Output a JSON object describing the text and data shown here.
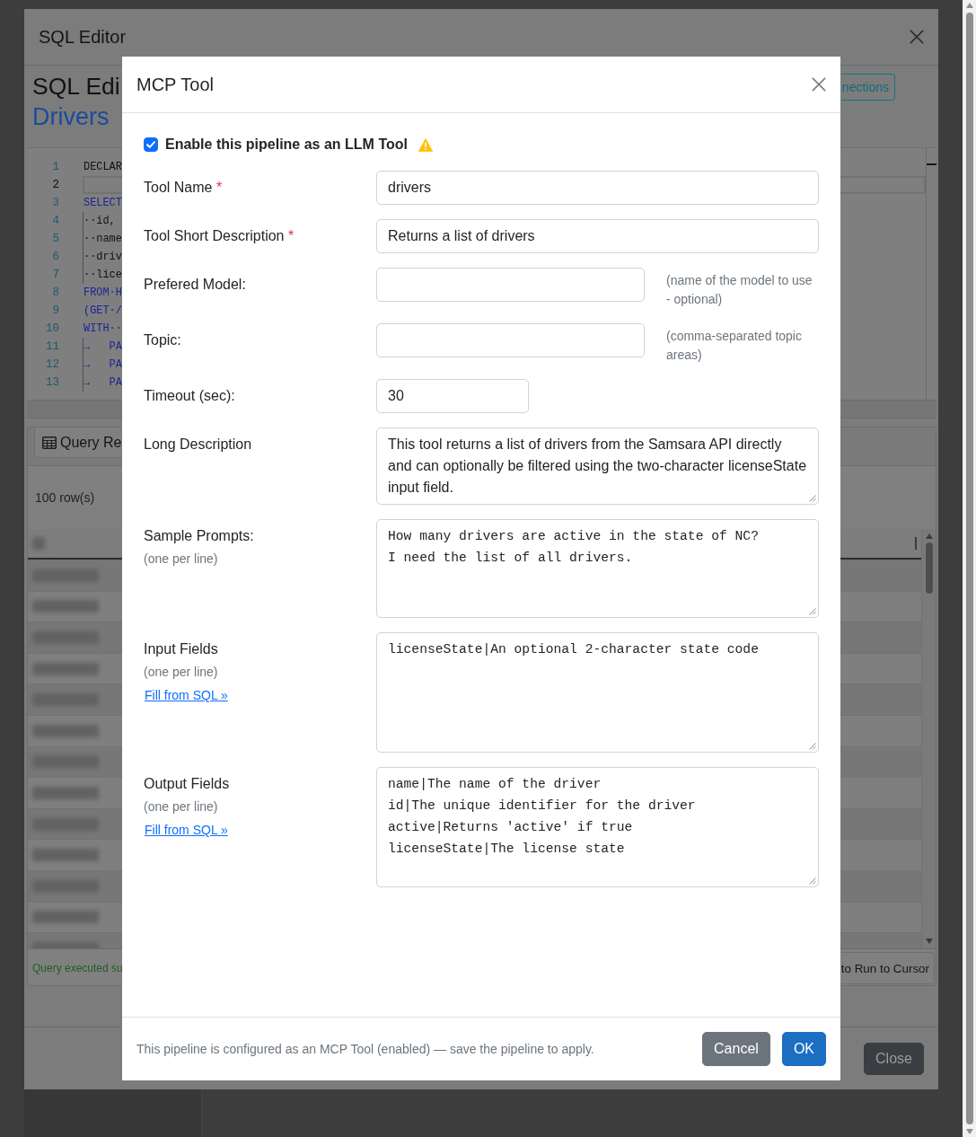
{
  "background_window": {
    "title": "SQL Editor",
    "heading": "SQL Edi",
    "subheading": "Drivers",
    "connections_button": "nections",
    "code_lines": [
      {
        "number": "1",
        "text": "DECLAR",
        "kind": "plain",
        "active": false,
        "indent_guide": false
      },
      {
        "number": "2",
        "active": true
      },
      {
        "number": "3",
        "text": "SELECT",
        "kind": "keyword",
        "active": false,
        "indent_guide": false
      },
      {
        "number": "4",
        "text": "··id,",
        "kind": "plain",
        "active": false,
        "indent_guide": true
      },
      {
        "number": "5",
        "text": "··name",
        "kind": "plain",
        "active": false,
        "indent_guide": true
      },
      {
        "number": "6",
        "text": "··driv",
        "kind": "plain",
        "active": false,
        "indent_guide": true
      },
      {
        "number": "7",
        "text": "··lice",
        "kind": "plain",
        "active": false,
        "indent_guide": true
      },
      {
        "number": "8",
        "text": "FROM·H",
        "kind": "keyword",
        "active": false,
        "indent_guide": false
      },
      {
        "number": "9",
        "text": "(GET·/",
        "kind": "keyword",
        "active": false,
        "indent_guide": false
      },
      {
        "number": "10",
        "text": "WITH··",
        "kind": "keyword",
        "active": false,
        "indent_guide": false
      },
      {
        "number": "11",
        "text": "→   PA",
        "kind": "keyword",
        "active": false,
        "indent_guide": true
      },
      {
        "number": "12",
        "text": "→   PA",
        "kind": "keyword",
        "active": false,
        "indent_guide": true
      },
      {
        "number": "13",
        "text": "→   PA",
        "kind": "keyword",
        "active": false,
        "indent_guide": true
      }
    ],
    "results_tab": "Query Re",
    "row_count": "100 row(s)",
    "status_message": "Query executed su",
    "status_hint": "to Run to Cursor",
    "close_button": "Close"
  },
  "dialog": {
    "title": "MCP Tool",
    "enable_checkbox": {
      "label": "Enable this pipeline as an LLM Tool",
      "checked": true,
      "warning": true
    },
    "fields": [
      {
        "kind": "text",
        "label": "Tool Name",
        "required_mark": "*",
        "value": "drivers"
      },
      {
        "kind": "text",
        "label": "Tool Short Description",
        "required_mark": "*",
        "value": "Returns a list of drivers"
      },
      {
        "kind": "hinted",
        "label": "Prefered Model:",
        "hint": "(name of the model to use - optional)"
      },
      {
        "kind": "hinted",
        "label": "Topic:",
        "hint": "(comma-separated topic areas)"
      },
      {
        "kind": "short",
        "label": "Timeout (sec):",
        "value": "30"
      },
      {
        "kind": "prose",
        "label": "Long Description",
        "value": "This tool returns a list of drivers from the Samsara API directly and can optionally be filtered using the two-character licenseState input field."
      },
      {
        "kind": "prompt_list",
        "label": "Sample Prompts:",
        "note": "(one per line)",
        "value": "How many drivers are active in the state of NC?\nI need the list of all drivers."
      },
      {
        "kind": "field_list",
        "label": "Input Fields",
        "note": "(one per line)",
        "link": "Fill from SQL »",
        "value": "licenseState|An optional 2-character state code"
      },
      {
        "kind": "field_list",
        "label": "Output Fields",
        "note": "(one per line)",
        "link": "Fill from SQL »",
        "value": "name|The name of the driver\nid|The unique identifier for the driver\nactive|Returns 'active' if true\nlicenseState|The license state"
      }
    ],
    "footer_note": "This pipeline is configured as an MCP Tool (enabled) — save the pipeline to apply.",
    "buttons": [
      {
        "label": "Cancel",
        "kind": "cancel"
      },
      {
        "label": "OK",
        "kind": "confirm"
      }
    ]
  }
}
